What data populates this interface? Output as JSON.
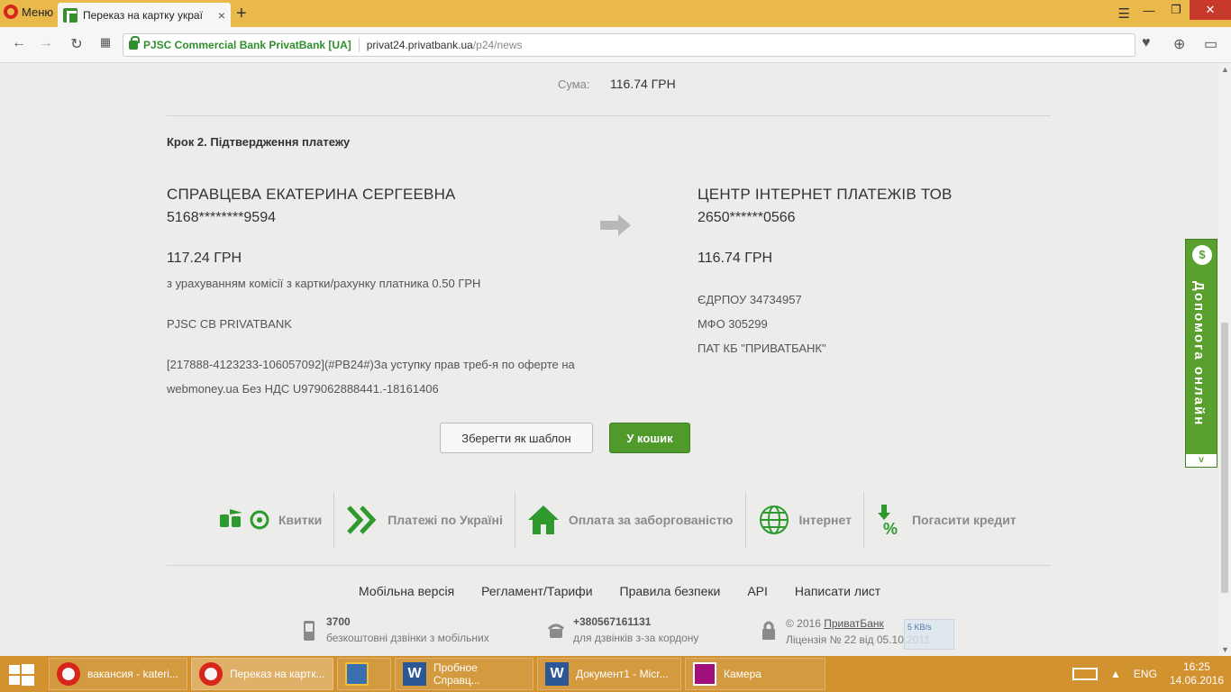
{
  "browser": {
    "menu_label": "Меню",
    "tab_title": "Переказ на картку украї",
    "tab_close": "×",
    "new_tab": "+",
    "secure_label": "PJSC Commercial Bank PrivatBank [UA]",
    "url_domain": "privat24.privatbank.ua",
    "url_path": "/p24/news"
  },
  "summary": {
    "sum_label": "Сума:",
    "sum_value": "116.74 ГРН"
  },
  "step_title": "Крок 2. Підтвердження платежу",
  "payer": {
    "name": "СПРАВЦЕВА ЕКАТЕРИНА СЕРГЕЕВНА",
    "card": "5168********9594",
    "amount": "117.24 ГРН",
    "commission": "з урахуванням комісії з картки/рахунку платника 0.50 ГРН",
    "bank": "PJSC CB PRIVATBANK",
    "purpose_line1": "[217888-4123233-106057092](#PB24#)За уступку прав треб-я по оферте на",
    "purpose_line2": "webmoney.ua Без НДС U979062888441.-18161406"
  },
  "payee": {
    "name": "ЦЕНТР ІНТЕРНЕТ ПЛАТЕЖІВ ТОВ",
    "card": "2650******0566",
    "amount": "116.74 ГРН",
    "edrpou": "ЄДРПОУ 34734957",
    "mfo": "МФО 305299",
    "bank": "ПАТ КБ \"ПРИВАТБАНК\""
  },
  "buttons": {
    "save_template": "Зберегти як шаблон",
    "to_cart": "У кошик"
  },
  "services": [
    {
      "label": "Квитки",
      "icon": "tickets-icon"
    },
    {
      "label": "Платежі по Україні",
      "icon": "chevrons-icon"
    },
    {
      "label": "Оплата за заборгованістю",
      "icon": "house-icon"
    },
    {
      "label": "Інтернет",
      "icon": "globe-icon"
    },
    {
      "label": "Погасити кредит",
      "icon": "percent-icon"
    }
  ],
  "footer": {
    "links": [
      "Мобільна версія",
      "Регламент/Тарифи",
      "Правила безпеки",
      "API",
      "Написати лист"
    ],
    "mobile_number": "3700",
    "mobile_desc": "безкоштовні дзвінки з мобільних",
    "abroad_number": "+380567161131",
    "abroad_desc": "для дзвінків з-за кордону",
    "copyright_prefix": "© 2016",
    "copyright_link": "ПриватБанк",
    "license": "Ліцензія № 22 від 05.10.2011"
  },
  "speed_widget": "5 KB/s",
  "help_tab": {
    "label": "Допомога онлайн",
    "toggle": "v",
    "icon_glyph": "$"
  },
  "taskbar": {
    "items": [
      {
        "label": "вакансия - kateri...",
        "icon": "opera-icon"
      },
      {
        "label": "Переказ на картк...",
        "icon": "opera-icon"
      },
      {
        "label": "",
        "icon": "explorer-icon"
      },
      {
        "label": "Пробное Справц...",
        "icon": "word-icon"
      },
      {
        "label": "Документ1 - Micr...",
        "icon": "word-icon"
      },
      {
        "label": "Камера",
        "icon": "camera-icon"
      }
    ],
    "lang": "ENG",
    "time": "16:25",
    "date": "14.06.2016"
  },
  "colors": {
    "accent_green": "#4f9a2b",
    "taskbar": "#d1922f",
    "tabbar": "#e9b94c"
  }
}
